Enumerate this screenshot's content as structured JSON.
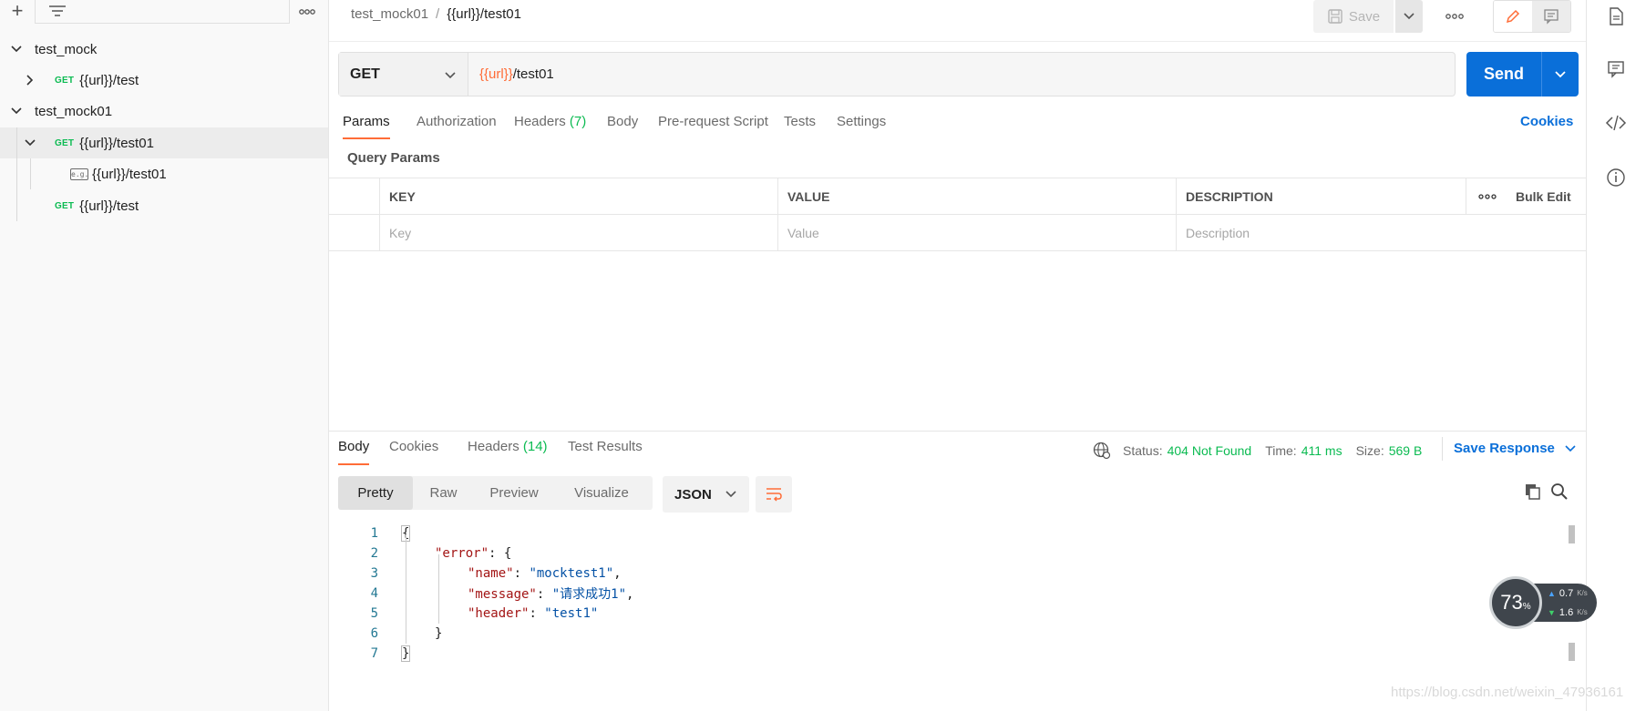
{
  "sidebar": {
    "tree": [
      {
        "label": "test_mock"
      },
      {
        "method": "GET",
        "label": "{{url}}/test"
      },
      {
        "label": "test_mock01"
      },
      {
        "method": "GET",
        "label": "{{url}}/test01"
      },
      {
        "example_icon": "e.g.",
        "label": "{{url}}/test01"
      },
      {
        "method": "GET",
        "label": "{{url}}/test"
      }
    ]
  },
  "header": {
    "breadcrumb_parent": "test_mock01",
    "breadcrumb_sep": "/",
    "breadcrumb_current": "{{url}}/test01",
    "save_label": "Save"
  },
  "request": {
    "method": "GET",
    "url_var": "{{url}}",
    "url_path": "/test01",
    "send_label": "Send",
    "tabs": [
      {
        "label": "Params"
      },
      {
        "label": "Authorization"
      },
      {
        "label": "Headers",
        "count": "(7)"
      },
      {
        "label": "Body"
      },
      {
        "label": "Pre-request Script"
      },
      {
        "label": "Tests"
      },
      {
        "label": "Settings"
      }
    ],
    "cookies_label": "Cookies",
    "query_params_title": "Query Params",
    "table_headers": {
      "key": "KEY",
      "value": "VALUE",
      "description": "DESCRIPTION",
      "bulk_edit": "Bulk Edit"
    },
    "placeholders": {
      "key": "Key",
      "value": "Value",
      "description": "Description"
    }
  },
  "response": {
    "tabs": [
      {
        "label": "Body"
      },
      {
        "label": "Cookies"
      },
      {
        "label": "Headers",
        "count": "(14)"
      },
      {
        "label": "Test Results"
      }
    ],
    "status_label": "Status:",
    "status_value": "404 Not Found",
    "time_label": "Time:",
    "time_value": "411 ms",
    "size_label": "Size:",
    "size_value": "569 B",
    "save_response_label": "Save Response",
    "view_modes": [
      "Pretty",
      "Raw",
      "Preview",
      "Visualize"
    ],
    "format": "JSON",
    "line_numbers": [
      "1",
      "2",
      "3",
      "4",
      "5",
      "6",
      "7"
    ],
    "code": {
      "open": "{",
      "error_key": "\"error\"",
      "name_key": "\"name\"",
      "name_val": "\"mocktest1\"",
      "message_key": "\"message\"",
      "message_val": "\"请求成功1\"",
      "header_key": "\"header\"",
      "header_val": "\"test1\"",
      "close_inner": "}",
      "close": "}"
    }
  },
  "overlay": {
    "net_percent": "73",
    "net_percent_unit": "%",
    "upload": "0.7",
    "upload_unit": "K/s",
    "download": "1.6",
    "download_unit": "K/s",
    "watermark": "https://blog.csdn.net/weixin_47936161"
  },
  "colors": {
    "accent_orange": "#ff6c37",
    "send_blue": "#0a6fd9",
    "method_green": "#0cbb52"
  },
  "icons": [
    "plus-icon",
    "filter-icon",
    "more-icon",
    "chevron-down-icon",
    "chevron-right-icon",
    "save-icon",
    "edit-icon",
    "comment-icon",
    "document-icon",
    "code-icon",
    "info-icon",
    "globe-icon",
    "wrap-icon",
    "copy-icon",
    "search-icon"
  ]
}
